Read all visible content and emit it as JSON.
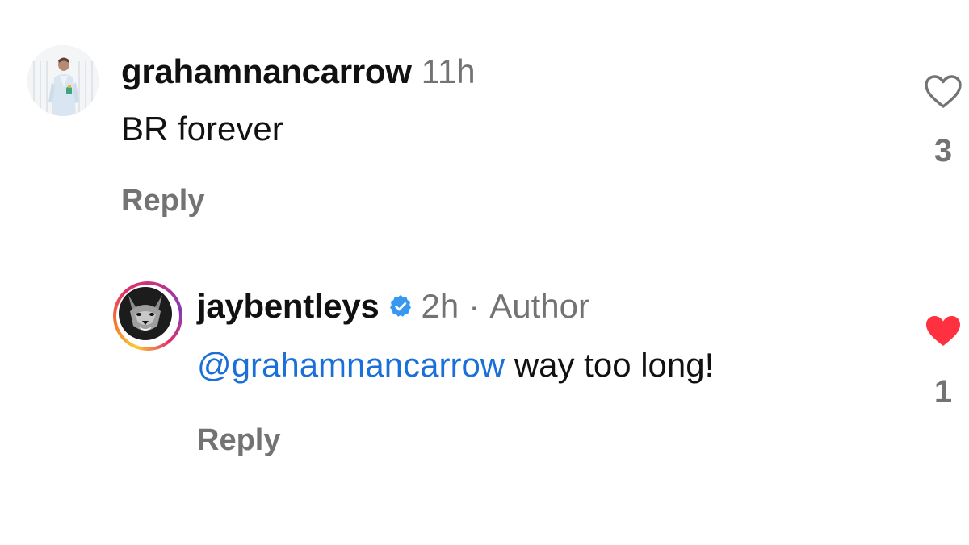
{
  "comments": [
    {
      "username": "grahamnancarrow",
      "time": "11h",
      "text": "BR forever",
      "reply_label": "Reply",
      "like_count": "3",
      "liked": false,
      "avatar_icon": "profile-photo-avatar"
    }
  ],
  "reply": {
    "username": "jaybentleys",
    "verified": true,
    "time": "2h",
    "separator": "·",
    "author_label": "Author",
    "mention": "@grahamnancarrow",
    "text": "way too long!",
    "reply_label": "Reply",
    "like_count": "1",
    "liked": true,
    "avatar_icon": "wolf-avatar"
  },
  "colors": {
    "mention": "#1a6fd8",
    "verified_badge": "#3897f0",
    "heart_liked": "#ff3040",
    "muted_text": "#737373"
  }
}
